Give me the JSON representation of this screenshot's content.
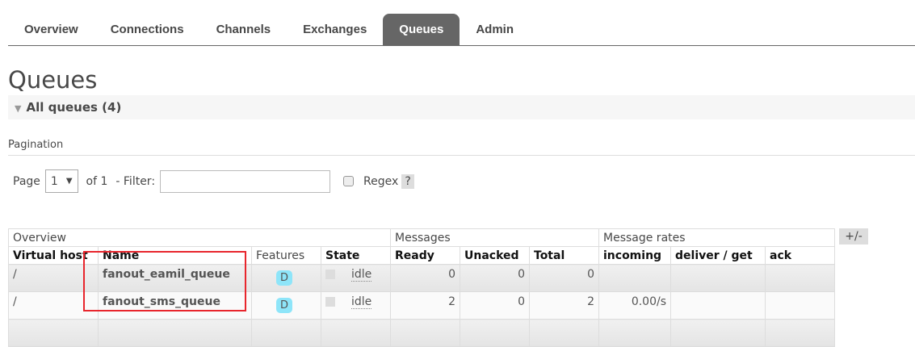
{
  "nav": {
    "tabs": [
      "Overview",
      "Connections",
      "Channels",
      "Exchanges",
      "Queues",
      "Admin"
    ],
    "active": "Queues"
  },
  "page_title": "Queues",
  "section": "All queues (4)",
  "pagination": {
    "heading": "Pagination",
    "page_label": "Page",
    "page_value": "1",
    "of_label": "of 1",
    "filter_label": "- Filter:",
    "filter_value": "",
    "regex_label": "Regex",
    "help": "?"
  },
  "table": {
    "groups": [
      "Overview",
      "Messages",
      "Message rates"
    ],
    "columns": [
      "Virtual host",
      "Name",
      "Features",
      "State",
      "Ready",
      "Unacked",
      "Total",
      "incoming",
      "deliver / get",
      "ack"
    ],
    "rows": [
      {
        "vhost": "/",
        "name": "fanout_eamil_queue",
        "features": "D",
        "state": "idle",
        "ready": "0",
        "unacked": "0",
        "total": "0",
        "incoming": "",
        "deliver": "",
        "ack": ""
      },
      {
        "vhost": "/",
        "name": "fanout_sms_queue",
        "features": "D",
        "state": "idle",
        "ready": "2",
        "unacked": "0",
        "total": "2",
        "incoming": "0.00/s",
        "deliver": "",
        "ack": ""
      }
    ],
    "toggle": "+/-"
  },
  "colors": {
    "active_tab": "#666666",
    "highlight": "#e8262d",
    "badge": "#8ee5f9"
  }
}
